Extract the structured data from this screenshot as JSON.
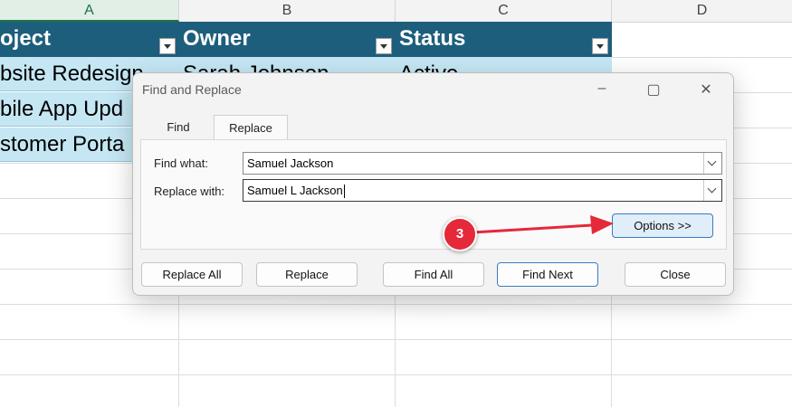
{
  "sheet": {
    "columns": [
      {
        "letter": "A",
        "selected": true
      },
      {
        "letter": "B",
        "selected": false
      },
      {
        "letter": "C",
        "selected": false
      },
      {
        "letter": "D",
        "selected": false
      }
    ],
    "table": {
      "headers": [
        "oject",
        "Owner",
        "Status"
      ],
      "rows": [
        [
          "bsite Redesign",
          "Sarah Johnson",
          "Active"
        ],
        [
          "bile App Upd",
          "",
          ""
        ],
        [
          "stomer Porta",
          "",
          ""
        ]
      ]
    }
  },
  "dialog": {
    "title": "Find and Replace",
    "tabs": {
      "find": "Find",
      "replace": "Replace"
    },
    "find_label": "Find what:",
    "find_value": "Samuel Jackson",
    "replace_label": "Replace with:",
    "replace_value": "Samuel L Jackson",
    "buttons": {
      "options": "Options >>",
      "replace_all": "Replace All",
      "replace": "Replace",
      "find_all": "Find All",
      "find_next": "Find Next",
      "close": "Close"
    }
  },
  "annotation": {
    "step": "3",
    "color": "#e5283a"
  },
  "colors": {
    "table_header": "#1d5e7c",
    "table_row": "#c5e7f4",
    "accent": "#217346"
  }
}
